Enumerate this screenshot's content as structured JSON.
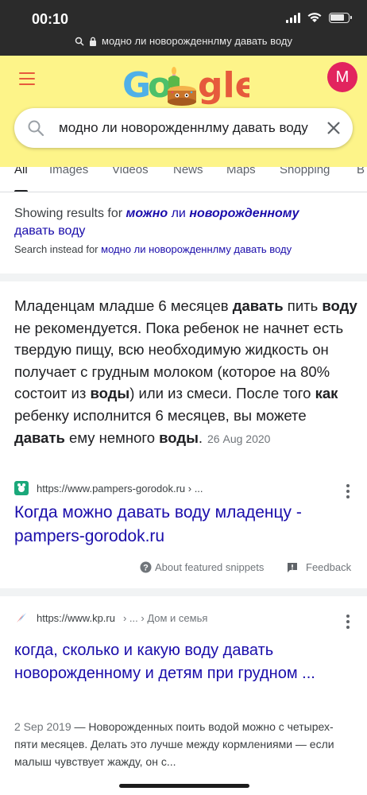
{
  "status": {
    "time": "00:10"
  },
  "browser": {
    "url": "модно ли новорожденнлму давать воду"
  },
  "header": {
    "logo_parts": [
      "G",
      "o",
      "gle"
    ],
    "avatar_letter": "M"
  },
  "search": {
    "query": "модно ли новорожденнлму давать воду"
  },
  "tabs": [
    {
      "label": "All"
    },
    {
      "label": "Images"
    },
    {
      "label": "Videos"
    },
    {
      "label": "News"
    },
    {
      "label": "Maps"
    },
    {
      "label": "Shopping"
    },
    {
      "label": "B"
    }
  ],
  "spelling": {
    "prefix": "Showing results for ",
    "word1": "можно",
    "word2": " ли ",
    "word3": "новорожденному",
    "word4": "давать воду",
    "instead_prefix": "Search instead for ",
    "instead_query": "модно ли новорожденнлму давать воду"
  },
  "featured": {
    "t1": "Младенцам младше 6 месяцев ",
    "b1": "давать",
    "t2": " пить ",
    "b2": "воду",
    "t3": " не рекомендуется. Пока ребенок не начнет есть твердую пищу, всю необходимую жидкость он получает с грудным молоком (которое на 80% состоит из ",
    "b3": "воды",
    "t4": ") или из смеси. После того ",
    "b4": "как",
    "t5": " ребенку исполнится 6 месяцев, вы можете ",
    "b5": "давать",
    "t6": " ему немного ",
    "b6": "воды",
    "t7": ".",
    "date": "26 Aug 2020",
    "source_url": "https://www.pampers-gorodok.ru › ...",
    "title": "Когда можно давать воду младенцу - pampers-gorodok.ru",
    "about_label": "About featured snippets",
    "feedback_label": "Feedback"
  },
  "result2": {
    "source_url": "https://www.kp.ru",
    "breadcrumb": " › ... › Дом и семья",
    "title": "когда, сколько и какую воду давать новорожденному и детям при грудном ...",
    "date": "2 Sep 2019",
    "snippet": " — Новорожденных поить водой можно с четырех-пяти месяцев. Делать это лучше между кормлениями — если малыш чувствует жажду, он с..."
  },
  "colors": {
    "header_bg": "#fdf489",
    "link": "#1a0dab",
    "avatar": "#e2245e",
    "menu": "#e65a3c"
  }
}
